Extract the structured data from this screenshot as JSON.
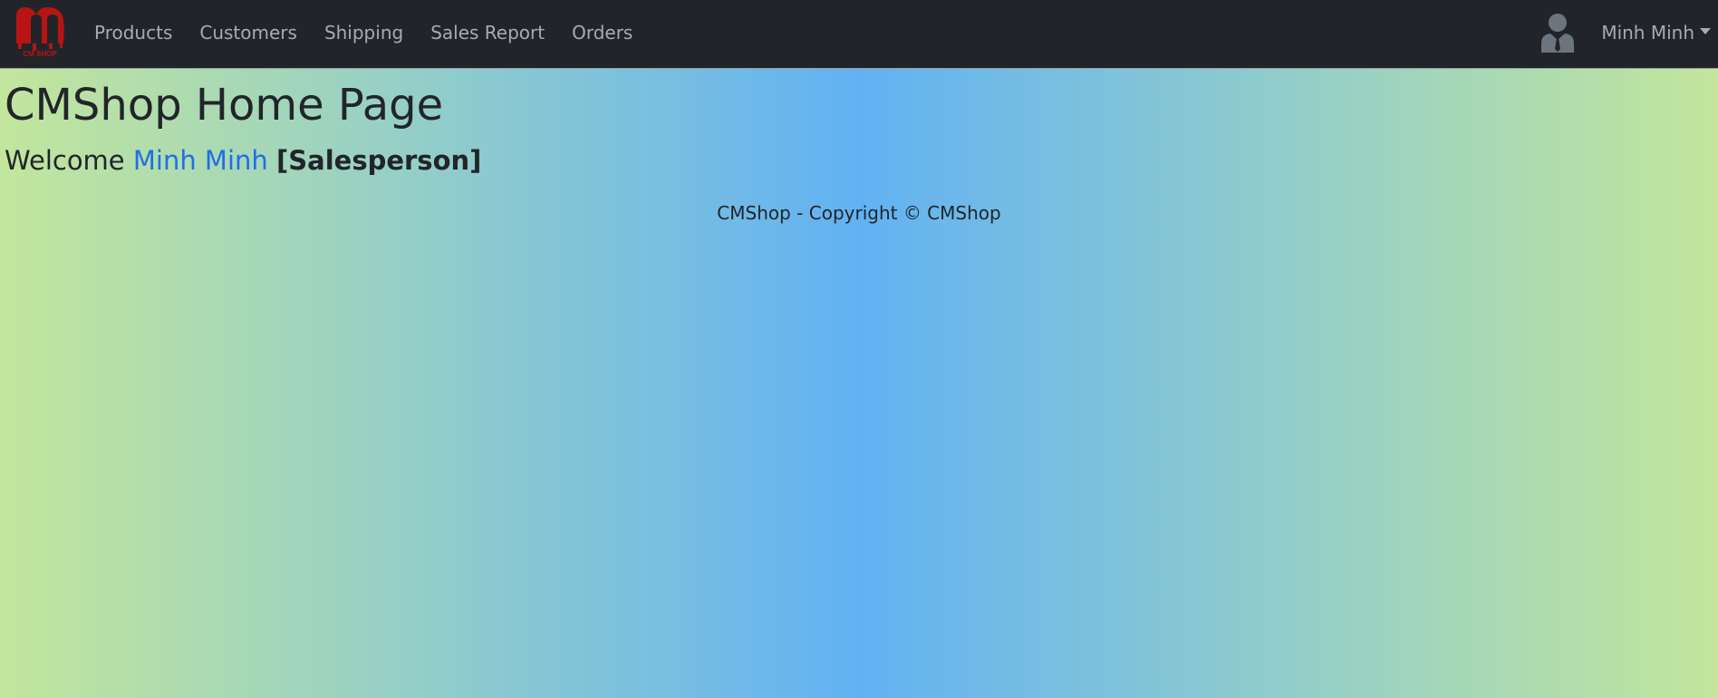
{
  "brand": {
    "logo_text": "CM SHOP",
    "color": "#b81414"
  },
  "nav": {
    "items": [
      {
        "label": "Products"
      },
      {
        "label": "Customers"
      },
      {
        "label": "Shipping"
      },
      {
        "label": "Sales Report"
      },
      {
        "label": "Orders"
      }
    ],
    "user_icon": "user-icon",
    "user_menu_label": "Minh Minh"
  },
  "main": {
    "title": "CMShop Home Page",
    "welcome_prefix": "Welcome",
    "user_name": "Minh Minh",
    "role": "[Salesperson]"
  },
  "footer": {
    "text": "CMShop - Copyright © CMShop"
  },
  "colors": {
    "navbar_bg": "#212529",
    "link": "#1f6fe5",
    "gradient_edge": "#c3e69c",
    "gradient_center": "#62b2f3"
  }
}
